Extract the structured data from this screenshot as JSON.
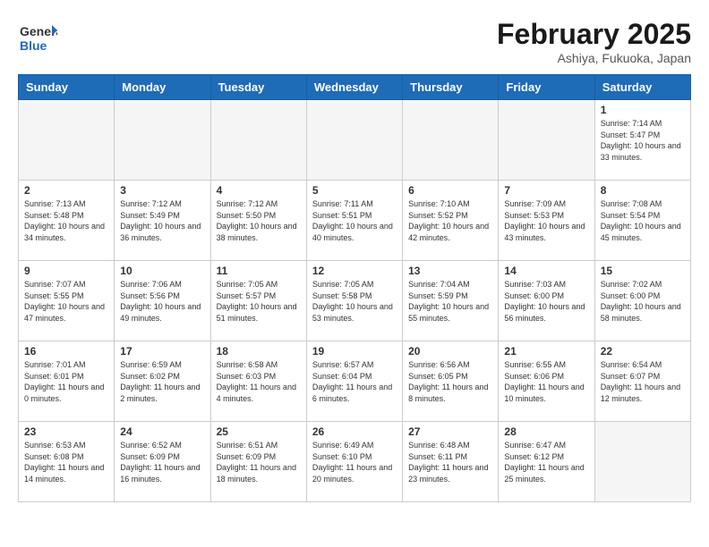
{
  "logo": {
    "line1": "General",
    "line2": "Blue"
  },
  "title": "February 2025",
  "subtitle": "Ashiya, Fukuoka, Japan",
  "weekdays": [
    "Sunday",
    "Monday",
    "Tuesday",
    "Wednesday",
    "Thursday",
    "Friday",
    "Saturday"
  ],
  "weeks": [
    [
      {
        "day": "",
        "info": ""
      },
      {
        "day": "",
        "info": ""
      },
      {
        "day": "",
        "info": ""
      },
      {
        "day": "",
        "info": ""
      },
      {
        "day": "",
        "info": ""
      },
      {
        "day": "",
        "info": ""
      },
      {
        "day": "1",
        "info": "Sunrise: 7:14 AM\nSunset: 5:47 PM\nDaylight: 10 hours\nand 33 minutes."
      }
    ],
    [
      {
        "day": "2",
        "info": "Sunrise: 7:13 AM\nSunset: 5:48 PM\nDaylight: 10 hours\nand 34 minutes."
      },
      {
        "day": "3",
        "info": "Sunrise: 7:12 AM\nSunset: 5:49 PM\nDaylight: 10 hours\nand 36 minutes."
      },
      {
        "day": "4",
        "info": "Sunrise: 7:12 AM\nSunset: 5:50 PM\nDaylight: 10 hours\nand 38 minutes."
      },
      {
        "day": "5",
        "info": "Sunrise: 7:11 AM\nSunset: 5:51 PM\nDaylight: 10 hours\nand 40 minutes."
      },
      {
        "day": "6",
        "info": "Sunrise: 7:10 AM\nSunset: 5:52 PM\nDaylight: 10 hours\nand 42 minutes."
      },
      {
        "day": "7",
        "info": "Sunrise: 7:09 AM\nSunset: 5:53 PM\nDaylight: 10 hours\nand 43 minutes."
      },
      {
        "day": "8",
        "info": "Sunrise: 7:08 AM\nSunset: 5:54 PM\nDaylight: 10 hours\nand 45 minutes."
      }
    ],
    [
      {
        "day": "9",
        "info": "Sunrise: 7:07 AM\nSunset: 5:55 PM\nDaylight: 10 hours\nand 47 minutes."
      },
      {
        "day": "10",
        "info": "Sunrise: 7:06 AM\nSunset: 5:56 PM\nDaylight: 10 hours\nand 49 minutes."
      },
      {
        "day": "11",
        "info": "Sunrise: 7:05 AM\nSunset: 5:57 PM\nDaylight: 10 hours\nand 51 minutes."
      },
      {
        "day": "12",
        "info": "Sunrise: 7:05 AM\nSunset: 5:58 PM\nDaylight: 10 hours\nand 53 minutes."
      },
      {
        "day": "13",
        "info": "Sunrise: 7:04 AM\nSunset: 5:59 PM\nDaylight: 10 hours\nand 55 minutes."
      },
      {
        "day": "14",
        "info": "Sunrise: 7:03 AM\nSunset: 6:00 PM\nDaylight: 10 hours\nand 56 minutes."
      },
      {
        "day": "15",
        "info": "Sunrise: 7:02 AM\nSunset: 6:00 PM\nDaylight: 10 hours\nand 58 minutes."
      }
    ],
    [
      {
        "day": "16",
        "info": "Sunrise: 7:01 AM\nSunset: 6:01 PM\nDaylight: 11 hours\nand 0 minutes."
      },
      {
        "day": "17",
        "info": "Sunrise: 6:59 AM\nSunset: 6:02 PM\nDaylight: 11 hours\nand 2 minutes."
      },
      {
        "day": "18",
        "info": "Sunrise: 6:58 AM\nSunset: 6:03 PM\nDaylight: 11 hours\nand 4 minutes."
      },
      {
        "day": "19",
        "info": "Sunrise: 6:57 AM\nSunset: 6:04 PM\nDaylight: 11 hours\nand 6 minutes."
      },
      {
        "day": "20",
        "info": "Sunrise: 6:56 AM\nSunset: 6:05 PM\nDaylight: 11 hours\nand 8 minutes."
      },
      {
        "day": "21",
        "info": "Sunrise: 6:55 AM\nSunset: 6:06 PM\nDaylight: 11 hours\nand 10 minutes."
      },
      {
        "day": "22",
        "info": "Sunrise: 6:54 AM\nSunset: 6:07 PM\nDaylight: 11 hours\nand 12 minutes."
      }
    ],
    [
      {
        "day": "23",
        "info": "Sunrise: 6:53 AM\nSunset: 6:08 PM\nDaylight: 11 hours\nand 14 minutes."
      },
      {
        "day": "24",
        "info": "Sunrise: 6:52 AM\nSunset: 6:09 PM\nDaylight: 11 hours\nand 16 minutes."
      },
      {
        "day": "25",
        "info": "Sunrise: 6:51 AM\nSunset: 6:09 PM\nDaylight: 11 hours\nand 18 minutes."
      },
      {
        "day": "26",
        "info": "Sunrise: 6:49 AM\nSunset: 6:10 PM\nDaylight: 11 hours\nand 20 minutes."
      },
      {
        "day": "27",
        "info": "Sunrise: 6:48 AM\nSunset: 6:11 PM\nDaylight: 11 hours\nand 23 minutes."
      },
      {
        "day": "28",
        "info": "Sunrise: 6:47 AM\nSunset: 6:12 PM\nDaylight: 11 hours\nand 25 minutes."
      },
      {
        "day": "",
        "info": ""
      }
    ]
  ]
}
